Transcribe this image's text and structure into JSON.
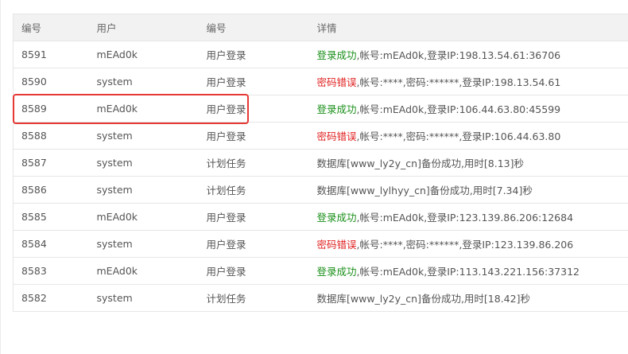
{
  "table": {
    "headers": [
      "编号",
      "用户",
      "编号",
      "详情"
    ],
    "rows": [
      {
        "id": "8591",
        "user": "mEAd0k",
        "type": "用户登录",
        "status": "登录成功",
        "status_kind": "success",
        "detail": ",帐号:mEAd0k,登录IP:198.13.54.61:36706"
      },
      {
        "id": "8590",
        "user": "system",
        "type": "用户登录",
        "status": "密码错误",
        "status_kind": "error",
        "detail": ",帐号:****,密码:******,登录IP:198.13.54.61"
      },
      {
        "id": "8589",
        "user": "mEAd0k",
        "type": "用户登录",
        "status": "登录成功",
        "status_kind": "success",
        "detail": ",帐号:mEAd0k,登录IP:106.44.63.80:45599"
      },
      {
        "id": "8588",
        "user": "system",
        "type": "用户登录",
        "status": "密码错误",
        "status_kind": "error",
        "detail": ",帐号:****,密码:******,登录IP:106.44.63.80"
      },
      {
        "id": "8587",
        "user": "system",
        "type": "计划任务",
        "status": "",
        "status_kind": "none",
        "detail": "数据库[www_ly2y_cn]备份成功,用时[8.13]秒"
      },
      {
        "id": "8586",
        "user": "system",
        "type": "计划任务",
        "status": "",
        "status_kind": "none",
        "detail": "数据库[www_lylhyy_cn]备份成功,用时[7.34]秒"
      },
      {
        "id": "8585",
        "user": "mEAd0k",
        "type": "用户登录",
        "status": "登录成功",
        "status_kind": "success",
        "detail": ",帐号:mEAd0k,登录IP:123.139.86.206:12684"
      },
      {
        "id": "8584",
        "user": "system",
        "type": "用户登录",
        "status": "密码错误",
        "status_kind": "error",
        "detail": ",帐号:****,密码:******,登录IP:123.139.86.206"
      },
      {
        "id": "8583",
        "user": "mEAd0k",
        "type": "用户登录",
        "status": "登录成功",
        "status_kind": "success",
        "detail": ",帐号:mEAd0k,登录IP:113.143.221.156:37312"
      },
      {
        "id": "8582",
        "user": "system",
        "type": "计划任务",
        "status": "",
        "status_kind": "none",
        "detail": "数据库[www_ly2y_cn]备份成功,用时[18.42]秒"
      }
    ]
  },
  "colors": {
    "success": "#1a8f1a",
    "error": "#e02020",
    "highlight": "#e53935"
  },
  "highlight_row_id": "8589"
}
